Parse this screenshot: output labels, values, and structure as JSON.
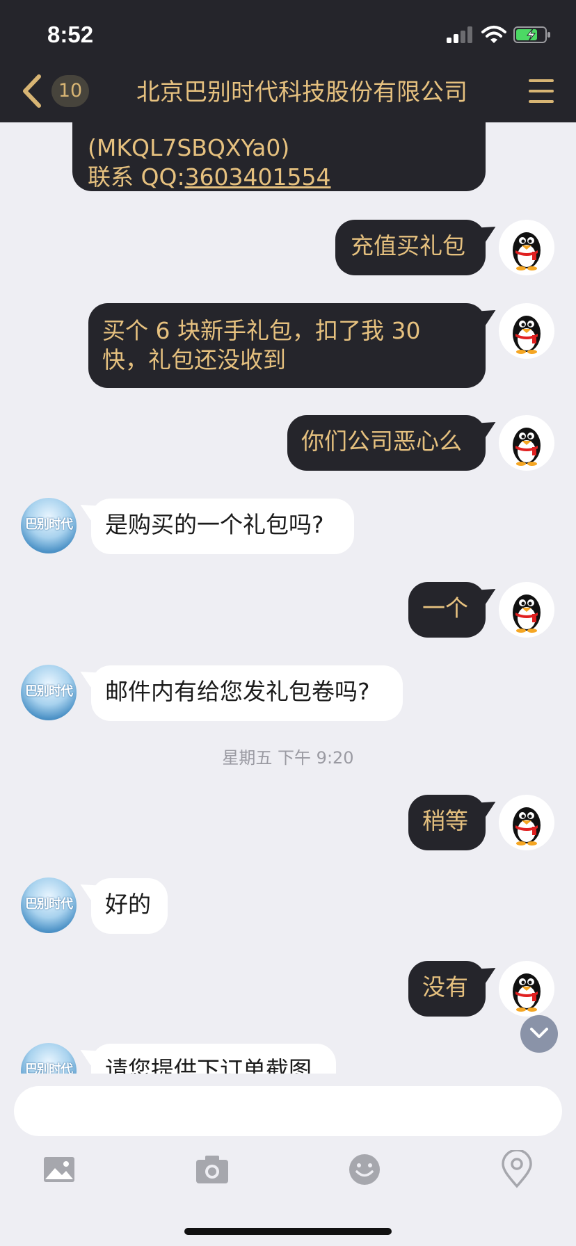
{
  "status_bar": {
    "time": "8:52"
  },
  "header": {
    "unread_count": "10",
    "title": "北京巴别时代科技股份有限公司"
  },
  "messages": {
    "m0_line1": "(MKQL7SBQXYa0)",
    "m0_line2_prefix": "联系 QQ:",
    "m0_line2_qq": "3603401554",
    "m1": "充值买礼包",
    "m2": "买个 6 块新手礼包，扣了我 30 快，礼包还没收到",
    "m3": "你们公司恶心么",
    "m4": "是购买的一个礼包吗?",
    "m5": "一个",
    "m6": "邮件内有给您发礼包卷吗?",
    "timestamp": "星期五 下午 9:20",
    "m7": "稍等",
    "m8": "好的",
    "m9": "没有",
    "m10": "请您提供下订单截图"
  },
  "avatars": {
    "company_logo_text": "巴别时代"
  },
  "input": {
    "placeholder": ""
  },
  "icons": {
    "back": "chevron-left-icon",
    "menu": "hamburger-menu-icon",
    "scroll": "chevron-down-icon",
    "toolbar": [
      "image-icon",
      "camera-icon",
      "emoji-icon",
      "location-pin-icon"
    ]
  },
  "colors": {
    "bar_background": "#25252b",
    "accent_gold": "#e6c17f",
    "chat_background": "#eeeef3",
    "incoming_bubble": "#ffffff",
    "outgoing_bubble": "#25252b"
  }
}
